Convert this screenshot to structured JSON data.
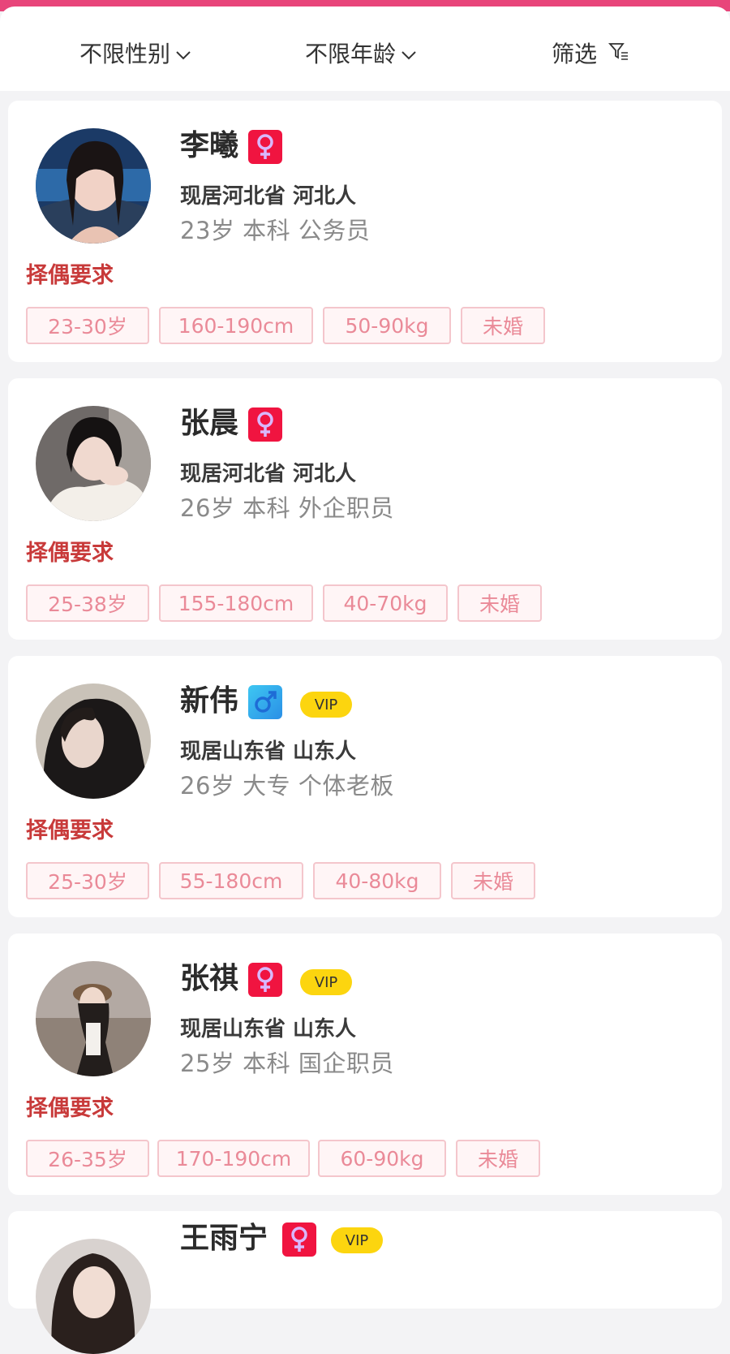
{
  "filters": {
    "gender": "不限性别",
    "age": "不限年龄",
    "filter": "筛选"
  },
  "colors": {
    "accent": "#e8457a",
    "female_badge": "#f01440",
    "male_badge": "#2a8fe6",
    "vip": "#fcd50f",
    "req_label": "#c83a3a",
    "tag_text": "#ea8a98"
  },
  "requirement_label": "择偶要求",
  "profiles": [
    {
      "name": "李曦",
      "gender": "female",
      "gender_icon": "female-symbol-icon",
      "vip": "",
      "location": "现居河北省 河北人",
      "info": "23岁 本科 公务员",
      "tags": [
        "23-30岁",
        "160-190cm",
        "50-90kg",
        "未婚"
      ]
    },
    {
      "name": "张晨",
      "gender": "female",
      "gender_icon": "female-symbol-icon",
      "vip": "",
      "location": "现居河北省 河北人",
      "info": "26岁 本科 外企职员",
      "tags": [
        "25-38岁",
        "155-180cm",
        "40-70kg",
        "未婚"
      ]
    },
    {
      "name": "新伟",
      "gender": "male",
      "gender_icon": "male-symbol-icon",
      "vip": "VIP",
      "location": "现居山东省 山东人",
      "info": "26岁 大专 个体老板",
      "tags": [
        "25-30岁",
        "55-180cm",
        "40-80kg",
        "未婚"
      ]
    },
    {
      "name": "张祺",
      "gender": "female",
      "gender_icon": "female-symbol-icon",
      "vip": "VIP",
      "location": "现居山东省 山东人",
      "info": "25岁 本科 国企职员",
      "tags": [
        "26-35岁",
        "170-190cm",
        "60-90kg",
        "未婚"
      ]
    },
    {
      "name": "王雨宁",
      "gender": "female",
      "gender_icon": "female-symbol-icon",
      "vip": "VIP"
    }
  ]
}
